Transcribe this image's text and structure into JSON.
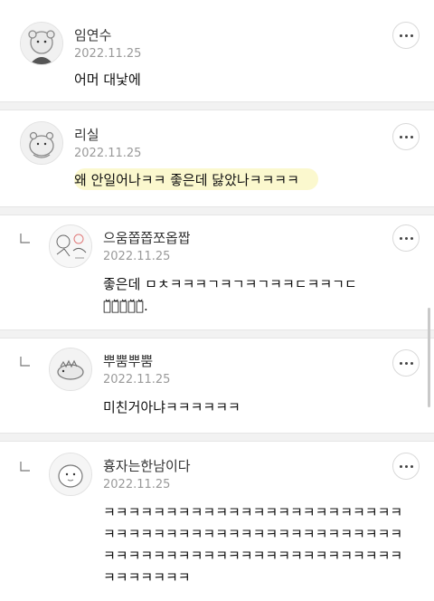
{
  "comments": [
    {
      "name": "임연수",
      "date": "2022.11.25",
      "text": "어머 대낯에"
    },
    {
      "name": "리실",
      "date": "2022.11.25",
      "text": "왜 안일어나ㅋㅋ 좋은데 닳았나ㅋㅋㅋㅋ"
    },
    {
      "name": "으움쫍쫍쪼옵짭",
      "date": "2022.11.25",
      "lines": [
        "좋은데 ㅁㅊㅋㅋㅋㄱㅋㄱㅋㄱㅋㅋㄷㅋㅋㄱㄷ",
        "ㅋ̆ㅋ̆ㅋ̆ㅋ̆ㅋ̆."
      ]
    },
    {
      "name": "뿌뿜뿌뿜",
      "date": "2022.11.25",
      "text": "미친거아냐ㅋㅋㅋㅋㅋㅋ"
    },
    {
      "name": "흉자는한남이다",
      "date": "2022.11.25",
      "lines": [
        "ㅋㅋㅋㅋㅋㅋㅋㅋㅋㅋㅋㅋㅋㅋㅋㅋㅋㅋㅋㅋㅋㅋㅋㅋ",
        "ㅋㅋㅋㅋㅋㅋㅋㅋㅋㅋㅋㅋㅋㅋㅋㅋㅋㅋㅋㅋㅋㅋㅋㅋ",
        "ㅋㅋㅋㅋㅋㅋㅋㅋㅋㅋㅋㅋㅋㅋㅋㅋㅋㅋㅋㅋㅋㅋㅋㅋ",
        "ㅋㅋㅋㅋㅋㅋㅋ"
      ]
    }
  ],
  "icons": {
    "more": "more-options-icon",
    "reply": "reply-arrow-icon",
    "avatar": "profile-avatar-icon"
  }
}
